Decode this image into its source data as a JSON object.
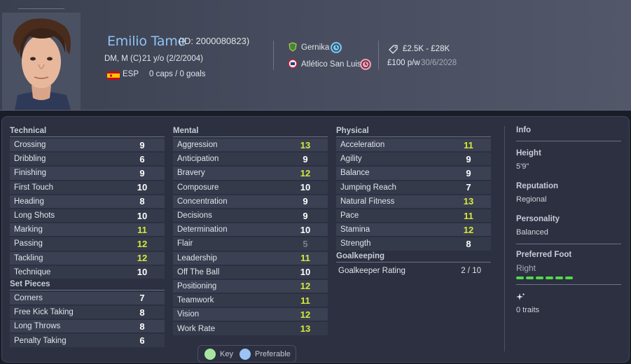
{
  "player": {
    "name": "Emilio Tame",
    "id_text": "(ID: 2000080823)",
    "positions": "DM, M (C)",
    "age": "21 y/o (2/2/2004)",
    "nationality": "ESP",
    "caps": "0 caps / 0 goals"
  },
  "clubs": {
    "club1": "Gernika",
    "club2": "Atlético San Luis"
  },
  "contract": {
    "value": "£2.5K - £28K",
    "wage": "£100 p/w",
    "expiry": "30/6/2028"
  },
  "technical": {
    "title": "Technical",
    "rows": [
      {
        "label": "Crossing",
        "value": "9"
      },
      {
        "label": "Dribbling",
        "value": "6"
      },
      {
        "label": "Finishing",
        "value": "9"
      },
      {
        "label": "First Touch",
        "value": "10"
      },
      {
        "label": "Heading",
        "value": "8"
      },
      {
        "label": "Long Shots",
        "value": "10"
      },
      {
        "label": "Marking",
        "value": "11"
      },
      {
        "label": "Passing",
        "value": "12"
      },
      {
        "label": "Tackling",
        "value": "12"
      },
      {
        "label": "Technique",
        "value": "10"
      }
    ]
  },
  "set_pieces": {
    "title": "Set Pieces",
    "rows": [
      {
        "label": "Corners",
        "value": "7"
      },
      {
        "label": "Free Kick Taking",
        "value": "8"
      },
      {
        "label": "Long Throws",
        "value": "8"
      },
      {
        "label": "Penalty Taking",
        "value": "6"
      }
    ]
  },
  "mental": {
    "title": "Mental",
    "rows": [
      {
        "label": "Aggression",
        "value": "13"
      },
      {
        "label": "Anticipation",
        "value": "9"
      },
      {
        "label": "Bravery",
        "value": "12"
      },
      {
        "label": "Composure",
        "value": "10"
      },
      {
        "label": "Concentration",
        "value": "9"
      },
      {
        "label": "Decisions",
        "value": "9"
      },
      {
        "label": "Determination",
        "value": "10"
      },
      {
        "label": "Flair",
        "value": "5"
      },
      {
        "label": "Leadership",
        "value": "11"
      },
      {
        "label": "Off The Ball",
        "value": "10"
      },
      {
        "label": "Positioning",
        "value": "12"
      },
      {
        "label": "Teamwork",
        "value": "11"
      },
      {
        "label": "Vision",
        "value": "12"
      },
      {
        "label": "Work Rate",
        "value": "13"
      }
    ]
  },
  "physical": {
    "title": "Physical",
    "rows": [
      {
        "label": "Acceleration",
        "value": "11"
      },
      {
        "label": "Agility",
        "value": "9"
      },
      {
        "label": "Balance",
        "value": "9"
      },
      {
        "label": "Jumping Reach",
        "value": "7"
      },
      {
        "label": "Natural Fitness",
        "value": "13"
      },
      {
        "label": "Pace",
        "value": "11"
      },
      {
        "label": "Stamina",
        "value": "12"
      },
      {
        "label": "Strength",
        "value": "8"
      }
    ]
  },
  "goalkeeping": {
    "title": "Goalkeeping",
    "label": "Goalkeeper Rating",
    "value": "2 / 10"
  },
  "info": {
    "title": "Info",
    "height_label": "Height",
    "height": "5'9\"",
    "reputation_label": "Reputation",
    "reputation": "Regional",
    "personality_label": "Personality",
    "personality": "Balanced",
    "foot_label": "Preferred Foot",
    "foot": "Right",
    "foot_strength_segments": 6,
    "traits": "0 traits"
  },
  "legend": {
    "key": "Key",
    "preferable": "Preferable",
    "key_color": "#a8e6a0",
    "preferable_color": "#9cc3f5"
  },
  "colors": {
    "name": "#8fc3f2",
    "high_attr": "#d6ea3c",
    "normal_attr": "#ffffff",
    "low_attr": "#7a7f8c",
    "foot_bar": "#4fd94a"
  }
}
